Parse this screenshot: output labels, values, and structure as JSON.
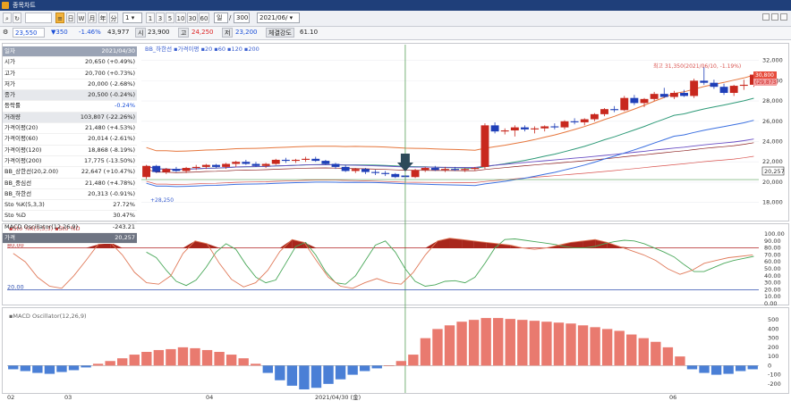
{
  "window": {
    "title": "종목차트"
  },
  "toolbar": {
    "count_value": "1",
    "periods": [
      "1",
      "3",
      "5",
      "10",
      "30",
      "60"
    ],
    "interval_value": "일",
    "interval_count": "300",
    "separator": "/",
    "date_value": "2021/06/",
    "marks": [
      "≡",
      "日",
      "W",
      "月",
      "年",
      "分",
      "틱"
    ]
  },
  "quote": {
    "price": "23,550",
    "change": "▼350",
    "change_pct": "-1.46%",
    "volume": "43,977",
    "labels": {
      "avg": "시",
      "high": "고",
      "low": "저"
    },
    "open": "23,900",
    "high": "24,250",
    "low": "23,200",
    "strength_label": "체결강도",
    "strength": "61.10"
  },
  "info_panel": [
    {
      "k": "일자",
      "v": "2021/04/30",
      "style": "hdr"
    },
    {
      "k": "시가",
      "v": "20,650 (+0.49%)"
    },
    {
      "k": "고가",
      "v": "20,700 (+0.73%)"
    },
    {
      "k": "저가",
      "v": "20,000 (-2.68%)"
    },
    {
      "k": "종가",
      "v": "20,500 (-0.24%)",
      "style": "gray"
    },
    {
      "k": "등락률",
      "v": "-0.24%",
      "vclass": "blue"
    },
    {
      "k": "거래량",
      "v": "103,807 (-22.26%)",
      "style": "gray"
    },
    {
      "k": "가격이평(20)",
      "v": "21,480 (+4.53%)"
    },
    {
      "k": "가격이평(60)",
      "v": "20,014 (-2.61%)"
    },
    {
      "k": "가격이평(120)",
      "v": "18,868 (-8.19%)"
    },
    {
      "k": "가격이평(200)",
      "v": "17,775 (-13.50%)"
    },
    {
      "k": "BB_상한선(20,2.00)",
      "v": "22,647 (+10.47%)"
    },
    {
      "k": "BB_중심선",
      "v": "21,480 (+4.78%)"
    },
    {
      "k": "BB_하한선",
      "v": "20,313 (-0.91%)"
    },
    {
      "k": "Sto %K(5,3,3)",
      "v": "27.72%"
    },
    {
      "k": "Sto %D",
      "v": "30.47%"
    },
    {
      "k": "MACD Oscillator(12,26,9)",
      "v": "-243.21"
    },
    {
      "k": "가격",
      "v": "20,257",
      "style": "dark"
    }
  ],
  "price_chart": {
    "legend": [
      "BB_하한선",
      "가격이평",
      "20",
      "60",
      "120",
      "200"
    ],
    "annotation_high": "최고 31,350(2021/06/10, -1.19%)",
    "annotation_low": "+28,250",
    "price_tag_top": "30,800",
    "price_tag_top2": "(29,873)",
    "price_tag_cursor": "20,257",
    "y_ticks": [
      "32,000",
      "30,000",
      "28,000",
      "26,000",
      "24,000",
      "22,000",
      "20,000",
      "18,000"
    ]
  },
  "sto_chart": {
    "legend_k": "Sto %K(5,3,3)",
    "legend_d": "Sto %D",
    "level_80": "80.00",
    "level_20": "20.00",
    "y_ticks": [
      "100.00",
      "90.00",
      "80.00",
      "70.00",
      "60.00",
      "50.00",
      "40.00",
      "30.00",
      "20.00",
      "10.00",
      "0.00"
    ]
  },
  "macd_chart": {
    "legend": "MACD Oscillator(12,26,9)",
    "y_ticks": [
      "500",
      "400",
      "300",
      "200",
      "100",
      "0",
      "-100",
      "-200"
    ]
  },
  "x_axis": {
    "labels": [
      "02",
      "03",
      "04",
      "2021/04/30 (金)",
      "06"
    ]
  },
  "chart_data": [
    {
      "type": "candlestick",
      "title": "",
      "y_ticks": [
        18000,
        20000,
        22000,
        24000,
        26000,
        28000,
        30000,
        32000
      ],
      "ylim": [
        17000,
        32500
      ],
      "candles": [
        [
          20500,
          21700,
          20300,
          21600
        ],
        [
          21600,
          21700,
          20900,
          21000
        ],
        [
          21000,
          21400,
          20800,
          21300
        ],
        [
          21300,
          21500,
          21000,
          21100
        ],
        [
          21100,
          21500,
          20900,
          21400
        ],
        [
          21400,
          21700,
          21200,
          21500
        ],
        [
          21500,
          21800,
          21300,
          21700
        ],
        [
          21700,
          21800,
          21400,
          21500
        ],
        [
          21500,
          21900,
          21300,
          21800
        ],
        [
          21800,
          22100,
          21500,
          22000
        ],
        [
          22000,
          22200,
          21700,
          21800
        ],
        [
          21800,
          22000,
          21500,
          21600
        ],
        [
          21600,
          21900,
          21400,
          21800
        ],
        [
          21800,
          22300,
          21700,
          22200
        ],
        [
          22200,
          22400,
          21900,
          22100
        ],
        [
          22100,
          22300,
          21900,
          22200
        ],
        [
          22200,
          22500,
          22000,
          22300
        ],
        [
          22300,
          22500,
          22000,
          22100
        ],
        [
          22100,
          22200,
          21700,
          21800
        ],
        [
          21800,
          21900,
          21300,
          21500
        ],
        [
          21500,
          21700,
          21000,
          21100
        ],
        [
          21100,
          21400,
          20900,
          21300
        ],
        [
          21300,
          21400,
          20800,
          21000
        ],
        [
          21000,
          21200,
          20700,
          20900
        ],
        [
          20900,
          21100,
          20600,
          20800
        ],
        [
          20800,
          20900,
          20400,
          20500
        ],
        [
          20650,
          20700,
          20000,
          20500
        ],
        [
          20500,
          21300,
          20400,
          21200
        ],
        [
          21200,
          21500,
          21000,
          21400
        ],
        [
          21400,
          21600,
          21100,
          21200
        ],
        [
          21200,
          21500,
          21000,
          21300
        ],
        [
          21300,
          21500,
          21100,
          21200
        ],
        [
          21200,
          21400,
          21000,
          21300
        ],
        [
          21300,
          21500,
          21100,
          21400
        ],
        [
          21500,
          25800,
          21300,
          25600
        ],
        [
          25600,
          25900,
          24800,
          25000
        ],
        [
          25000,
          25300,
          24700,
          25100
        ],
        [
          25100,
          25600,
          24500,
          25400
        ],
        [
          25400,
          25600,
          25000,
          25200
        ],
        [
          25200,
          25500,
          24800,
          25300
        ],
        [
          25300,
          25600,
          25000,
          25500
        ],
        [
          25500,
          25800,
          25200,
          25400
        ],
        [
          25400,
          26100,
          25200,
          26000
        ],
        [
          26000,
          26300,
          25700,
          25900
        ],
        [
          25900,
          26300,
          25600,
          26200
        ],
        [
          26200,
          26800,
          26000,
          26700
        ],
        [
          26700,
          27300,
          26500,
          27200
        ],
        [
          27200,
          27500,
          26900,
          27100
        ],
        [
          27100,
          28500,
          27000,
          28300
        ],
        [
          28300,
          28600,
          27600,
          27800
        ],
        [
          27800,
          28300,
          27400,
          28200
        ],
        [
          28200,
          28900,
          28000,
          28700
        ],
        [
          28700,
          29300,
          28300,
          28400
        ],
        [
          28400,
          29000,
          28200,
          28800
        ],
        [
          28800,
          29100,
          28400,
          28500
        ],
        [
          28500,
          30200,
          28300,
          30000
        ],
        [
          30000,
          31350,
          29600,
          29800
        ],
        [
          29800,
          30100,
          29200,
          29400
        ],
        [
          29400,
          29700,
          28600,
          28800
        ],
        [
          28800,
          29600,
          28500,
          29500
        ],
        [
          29500,
          30100,
          29100,
          29600
        ],
        [
          29600,
          30800,
          29400,
          30600
        ]
      ]
    },
    {
      "type": "line",
      "title": "",
      "series": [
        {
          "name": "Sto %K(5,3,3)",
          "values": [
            72,
            60,
            38,
            25,
            22,
            40,
            62,
            85,
            88,
            70,
            45,
            30,
            28,
            40,
            72,
            90,
            86,
            58,
            35,
            24,
            30,
            48,
            75,
            92,
            88,
            62,
            38,
            25,
            22,
            30,
            36,
            30,
            28,
            45,
            70,
            90,
            94,
            92,
            90,
            88,
            86,
            84,
            80,
            78,
            80,
            84,
            88,
            90,
            92,
            88,
            82,
            76,
            70,
            62,
            50,
            42,
            48,
            58,
            62,
            66,
            68,
            70
          ]
        },
        {
          "name": "Sto %D",
          "values": [
            74,
            66,
            48,
            32,
            26,
            34,
            52,
            74,
            86,
            78,
            56,
            38,
            30,
            34,
            58,
            82,
            88,
            70,
            46,
            30,
            28,
            40,
            62,
            84,
            90,
            74,
            50,
            32,
            25,
            27,
            32,
            33,
            30,
            38,
            58,
            80,
            92,
            93,
            91,
            89,
            87,
            85,
            82,
            80,
            80,
            82,
            86,
            89,
            91,
            90,
            86,
            80,
            74,
            67,
            56,
            46,
            46,
            52,
            58,
            62,
            65,
            68
          ]
        }
      ],
      "ylim": [
        0,
        100
      ],
      "y_ticks": [
        0,
        10,
        20,
        30,
        40,
        50,
        60,
        70,
        80,
        90,
        100
      ],
      "levels": [
        20,
        80
      ]
    },
    {
      "type": "bar",
      "title": "",
      "name": "MACD Oscillator(12,26,9)",
      "values": [
        -40,
        -60,
        -80,
        -90,
        -70,
        -50,
        -20,
        20,
        50,
        80,
        120,
        150,
        170,
        180,
        200,
        190,
        170,
        150,
        120,
        80,
        20,
        -80,
        -160,
        -220,
        -260,
        -243,
        -200,
        -150,
        -100,
        -60,
        -30,
        0,
        50,
        120,
        300,
        400,
        440,
        480,
        500,
        520,
        520,
        510,
        500,
        490,
        480,
        470,
        460,
        440,
        420,
        400,
        380,
        340,
        300,
        260,
        200,
        100,
        -40,
        -80,
        -100,
        -90,
        -60,
        -40
      ],
      "ylim": [
        -260,
        560
      ],
      "y_ticks": [
        -200,
        -100,
        0,
        100,
        200,
        300,
        400,
        500
      ]
    }
  ]
}
